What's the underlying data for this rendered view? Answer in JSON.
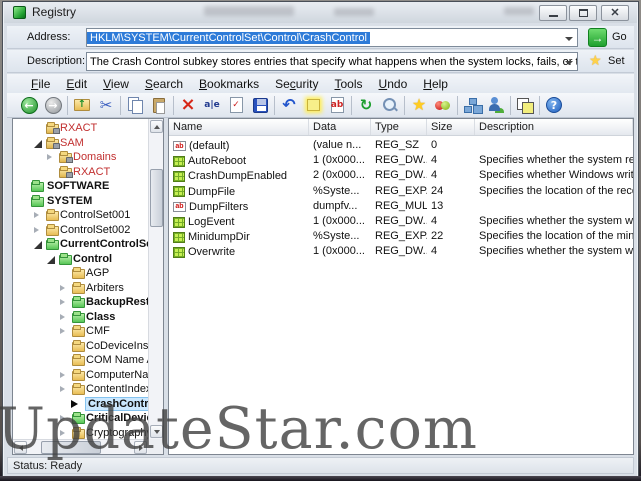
{
  "window": {
    "title": "Registry",
    "status": "Status: Ready"
  },
  "address_bar": {
    "label": "Address:",
    "value": "HKLM\\SYSTEM\\CurrentControlSet\\Control\\CrashControl",
    "go_label": "Go"
  },
  "description_bar": {
    "label": "Description:",
    "value": "The Crash Control subkey stores entries that specify what happens when the system locks, fails, or terminates",
    "set_label": "Set"
  },
  "menu": {
    "items": [
      {
        "label": "File",
        "accel": 0
      },
      {
        "label": "Edit",
        "accel": 0
      },
      {
        "label": "View",
        "accel": 0
      },
      {
        "label": "Search",
        "accel": 0
      },
      {
        "label": "Bookmarks",
        "accel": 0
      },
      {
        "label": "Security",
        "accel": 2
      },
      {
        "label": "Tools",
        "accel": 0
      },
      {
        "label": "Undo",
        "accel": 0
      },
      {
        "label": "Help",
        "accel": 0
      }
    ]
  },
  "toolbar": {
    "buttons": [
      "back",
      "forward",
      "sep",
      "up-folder",
      "cut",
      "sep",
      "copy",
      "paste",
      "sep",
      "delete",
      "rename",
      "apply",
      "save",
      "sep",
      "undo",
      "highlight",
      "export-ab",
      "sep",
      "refresh",
      "find",
      "sep",
      "favorites",
      "compare",
      "sep",
      "network",
      "permissions",
      "sep",
      "windows",
      "sep",
      "help"
    ]
  },
  "tree": {
    "items": [
      {
        "label": "RXACT",
        "level": 1,
        "arrow": "none",
        "folder": "lock",
        "red": true
      },
      {
        "label": "SAM",
        "level": 1,
        "arrow": "expanded",
        "folder": "lock",
        "red": true
      },
      {
        "label": "Domains",
        "level": 2,
        "arrow": "collapsed",
        "folder": "lock",
        "red": true
      },
      {
        "label": "RXACT",
        "level": 2,
        "arrow": "none",
        "folder": "lock",
        "red": true
      },
      {
        "label": "SOFTWARE",
        "level": 0,
        "arrow": "none",
        "folder": "green",
        "bold": true
      },
      {
        "label": "SYSTEM",
        "level": 0,
        "arrow": "none",
        "folder": "green",
        "bold": true
      },
      {
        "label": "ControlSet001",
        "level": 1,
        "arrow": "collapsed",
        "folder": "yellow"
      },
      {
        "label": "ControlSet002",
        "level": 1,
        "arrow": "collapsed",
        "folder": "yellow"
      },
      {
        "label": "CurrentControlSet",
        "level": 1,
        "arrow": "expanded",
        "folder": "green",
        "bold": true
      },
      {
        "label": "Control",
        "level": 2,
        "arrow": "expanded",
        "folder": "green",
        "bold": true
      },
      {
        "label": "AGP",
        "level": 3,
        "arrow": "none",
        "folder": "yellow"
      },
      {
        "label": "Arbiters",
        "level": 3,
        "arrow": "collapsed",
        "folder": "yellow"
      },
      {
        "label": "BackupRestor",
        "level": 3,
        "arrow": "collapsed",
        "folder": "green",
        "bold": true
      },
      {
        "label": "Class",
        "level": 3,
        "arrow": "collapsed",
        "folder": "green",
        "bold": true
      },
      {
        "label": "CMF",
        "level": 3,
        "arrow": "collapsed",
        "folder": "yellow"
      },
      {
        "label": "CoDeviceInstal",
        "level": 3,
        "arrow": "none",
        "folder": "yellow"
      },
      {
        "label": "COM Name Ar",
        "level": 3,
        "arrow": "none",
        "folder": "yellow"
      },
      {
        "label": "ComputerNam",
        "level": 3,
        "arrow": "collapsed",
        "folder": "yellow"
      },
      {
        "label": "ContentIndex",
        "level": 3,
        "arrow": "collapsed",
        "folder": "yellow"
      },
      {
        "label": "CrashControl",
        "level": 3,
        "arrow": "selected",
        "folder": "none",
        "bold": true,
        "selected": true
      },
      {
        "label": "CriticalDevice",
        "level": 3,
        "arrow": "collapsed",
        "folder": "green",
        "bold": true
      },
      {
        "label": "Cryptography",
        "level": 3,
        "arrow": "collapsed",
        "folder": "yellow"
      }
    ]
  },
  "list": {
    "columns": [
      "Name",
      "Data",
      "Type",
      "Size",
      "Description"
    ],
    "rows": [
      {
        "icon": "string",
        "name": "(default)",
        "data": "(value n...",
        "type": "REG_SZ",
        "size": "0",
        "description": ""
      },
      {
        "icon": "dword",
        "name": "AutoReboot",
        "data": "1  (0x000...",
        "type": "REG_DW...",
        "size": "4",
        "description": "Specifies whether the system rest..."
      },
      {
        "icon": "dword",
        "name": "CrashDumpEnabled",
        "data": "2  (0x000...",
        "type": "REG_DW...",
        "size": "4",
        "description": "Specifies whether Windows write..."
      },
      {
        "icon": "dword",
        "name": "DumpFile",
        "data": "%Syste...",
        "type": "REG_EXP...",
        "size": "24",
        "description": "Specifies the location of the reco..."
      },
      {
        "icon": "string",
        "name": "DumpFilters",
        "data": "dumpfv...",
        "type": "REG_MUL...",
        "size": "13",
        "description": ""
      },
      {
        "icon": "dword",
        "name": "LogEvent",
        "data": "1  (0x000...",
        "type": "REG_DW...",
        "size": "4",
        "description": "Specifies whether the system writ..."
      },
      {
        "icon": "dword",
        "name": "MinidumpDir",
        "data": "%Syste...",
        "type": "REG_EXP...",
        "size": "22",
        "description": "Specifies the location of the mini..."
      },
      {
        "icon": "dword",
        "name": "Overwrite",
        "data": "1  (0x000...",
        "type": "REG_DW...",
        "size": "4",
        "description": "Specifies whether the system writ..."
      }
    ]
  },
  "watermark": {
    "text": "UpdateStar.com"
  }
}
